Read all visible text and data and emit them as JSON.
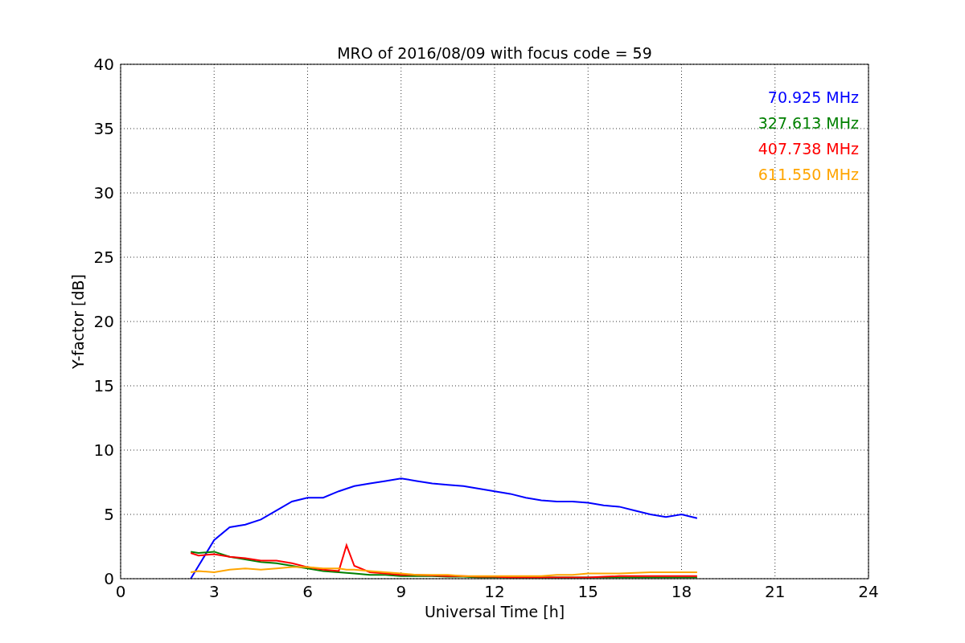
{
  "chart_data": {
    "type": "line",
    "title": "MRO of 2016/08/09 with focus code = 59",
    "xlabel": "Universal Time [h]",
    "ylabel": "Y-factor [dB]",
    "x": [
      2.25,
      2.5,
      3,
      3.5,
      4,
      4.5,
      5,
      5.5,
      6,
      6.5,
      7,
      7.25,
      7.5,
      8,
      8.5,
      9,
      9.5,
      10,
      10.5,
      11,
      11.5,
      12,
      12.5,
      13,
      13.5,
      14,
      14.5,
      15,
      15.5,
      16,
      16.5,
      17,
      17.5,
      18,
      18.5
    ],
    "series": [
      {
        "name": "70.925 MHz",
        "color": "#0000ff",
        "values": [
          0,
          1,
          3,
          4,
          4.2,
          4.6,
          5.3,
          6,
          6.3,
          6.3,
          6.8,
          7.0,
          7.2,
          7.4,
          7.6,
          7.8,
          7.6,
          7.4,
          7.3,
          7.2,
          7.0,
          6.8,
          6.6,
          6.3,
          6.1,
          6.0,
          6.0,
          5.9,
          5.7,
          5.6,
          5.3,
          5.0,
          4.8,
          5.0,
          4.7
        ]
      },
      {
        "name": "327.613 MHz",
        "color": "#008000",
        "values": [
          2.1,
          2.0,
          2.1,
          1.7,
          1.5,
          1.3,
          1.2,
          1.0,
          0.8,
          0.6,
          0.5,
          0.45,
          0.4,
          0.3,
          0.3,
          0.2,
          0.2,
          0.2,
          0.15,
          0.15,
          0.1,
          0.1,
          0.1,
          0.1,
          0.1,
          0.1,
          0.1,
          0.1,
          0.1,
          0.1,
          0.1,
          0.1,
          0.1,
          0.1,
          0.1
        ]
      },
      {
        "name": "407.738 MHz",
        "color": "#ff0000",
        "values": [
          2.0,
          1.8,
          1.9,
          1.7,
          1.6,
          1.4,
          1.4,
          1.2,
          0.9,
          0.7,
          0.6,
          2.6,
          1.0,
          0.5,
          0.4,
          0.3,
          0.3,
          0.25,
          0.2,
          0.2,
          0.15,
          0.15,
          0.1,
          0.1,
          0.1,
          0.1,
          0.1,
          0.1,
          0.15,
          0.2,
          0.2,
          0.2,
          0.2,
          0.2,
          0.2
        ]
      },
      {
        "name": "611.550 MHz",
        "color": "#ffa500",
        "values": [
          0.5,
          0.6,
          0.5,
          0.7,
          0.8,
          0.7,
          0.8,
          0.9,
          0.9,
          0.8,
          0.8,
          0.7,
          0.7,
          0.6,
          0.5,
          0.4,
          0.3,
          0.3,
          0.3,
          0.2,
          0.2,
          0.2,
          0.2,
          0.2,
          0.2,
          0.3,
          0.3,
          0.4,
          0.4,
          0.4,
          0.45,
          0.5,
          0.5,
          0.5,
          0.5
        ]
      }
    ],
    "grid": true,
    "xlim": [
      0,
      24
    ],
    "ylim": [
      0,
      40
    ],
    "xticks": [
      0,
      3,
      6,
      9,
      12,
      15,
      18,
      21,
      24
    ],
    "yticks": [
      0,
      5,
      10,
      15,
      20,
      25,
      30,
      35,
      40
    ]
  }
}
